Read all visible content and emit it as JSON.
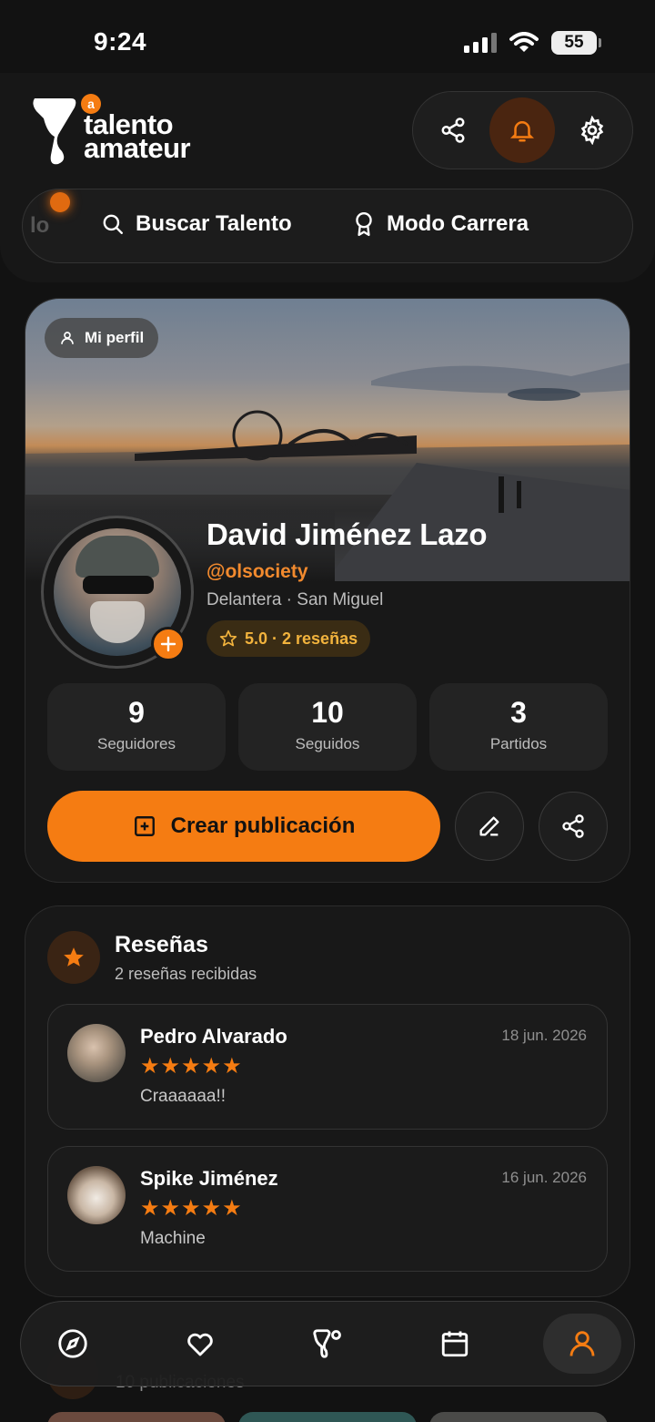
{
  "status_bar": {
    "time": "9:24",
    "battery": "55"
  },
  "header": {
    "logo_text_line1": "talento",
    "logo_text_line2": "amateur",
    "logo_badge": "a"
  },
  "nav": {
    "ghost_label": "lo",
    "items": [
      {
        "label": "Buscar Talento",
        "icon": "search-icon"
      },
      {
        "label": "Modo Carrera",
        "icon": "award-icon"
      }
    ]
  },
  "profile": {
    "badge_label": "Mi perfil",
    "name": "David Jiménez Lazo",
    "handle": "@olsociety",
    "meta": "Delantera · San Miguel",
    "rating": "5.0 · 2 reseñas",
    "stats": [
      {
        "value": "9",
        "label": "Seguidores"
      },
      {
        "value": "10",
        "label": "Seguidos"
      },
      {
        "value": "3",
        "label": "Partidos"
      }
    ],
    "create_label": "Crear publicación"
  },
  "reviews": {
    "title": "Reseñas",
    "subtitle": "2 reseñas recibidas",
    "items": [
      {
        "name": "Pedro Alvarado",
        "date": "18 jun. 2026",
        "stars": "★★★★★",
        "text": "Craaaaaa!!"
      },
      {
        "name": "Spike Jiménez",
        "date": "16 jun. 2026",
        "stars": "★★★★★",
        "text": "Machine"
      }
    ]
  },
  "peek": {
    "text": "10 publicaciones"
  },
  "tabbar": {
    "tabs": [
      "compass-icon",
      "heart-icon",
      "talento-logo-icon",
      "calendar-icon",
      "user-icon"
    ],
    "active_index": 4
  },
  "colors": {
    "accent": "#f57c12",
    "background": "#121212",
    "card": "#181818",
    "rating": "#f2b33d"
  }
}
